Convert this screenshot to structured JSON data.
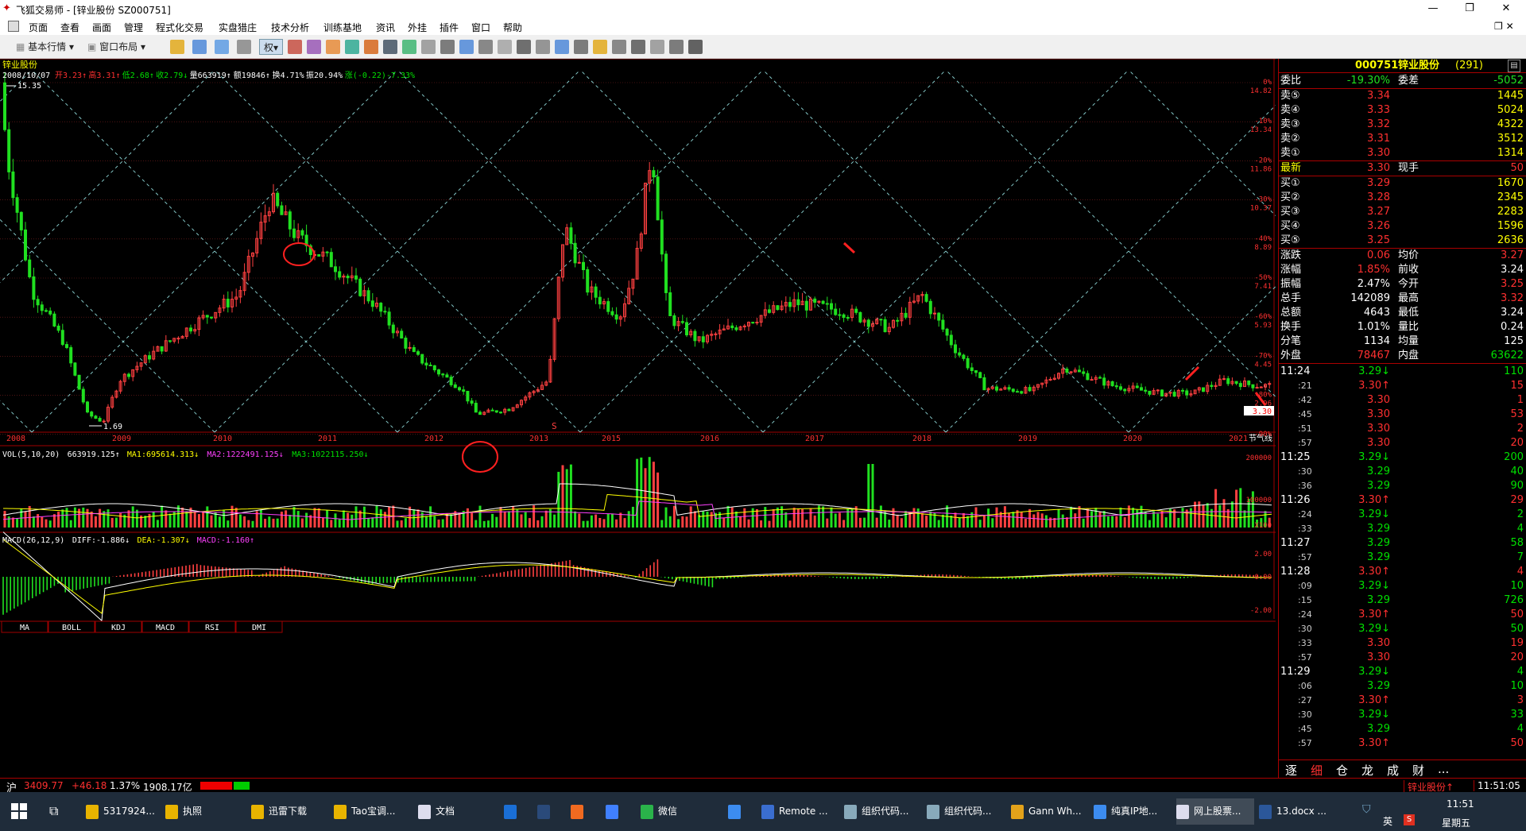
{
  "window": {
    "title": "飞狐交易师 - [锌业股份 SZ000751]"
  },
  "menu": [
    "页面",
    "查看",
    "画面",
    "管理",
    "程式化交易",
    "实盘猎庄",
    "技术分析",
    "训练基地",
    "资讯",
    "外挂",
    "插件",
    "窗口",
    "帮助"
  ],
  "toolbar": {
    "basic": "基本行情",
    "layout": "窗口布局",
    "quan": "权"
  },
  "chart": {
    "stock_name": "锌业股份",
    "info_date": "2008/10/07",
    "info_items": [
      {
        "t": "开3.23↑",
        "c": "#ff3030"
      },
      {
        "t": "高3.31↑",
        "c": "#ff3030"
      },
      {
        "t": "低2.68↑",
        "c": "#00e000"
      },
      {
        "t": "收2.79↓",
        "c": "#00e000"
      },
      {
        "t": "量663919↑",
        "c": "#ffffff"
      },
      {
        "t": "额19846↑",
        "c": "#ffffff"
      },
      {
        "t": "换4.71%",
        "c": "#ffffff"
      },
      {
        "t": "振20.94%",
        "c": "#ffffff"
      },
      {
        "t": "涨(-0.22)-7.33%",
        "c": "#00e000"
      }
    ],
    "high_label": "15.35",
    "low_label": "1.69",
    "s_mark": "S",
    "years": [
      "2008",
      "2009",
      "2010",
      "2011",
      "2012",
      "2013",
      "2015",
      "2016",
      "2017",
      "2018",
      "2019",
      "2020",
      "2021"
    ],
    "right_labels": [
      {
        "p": "0%",
        "v": "14.82"
      },
      {
        "p": "-10%",
        "v": "13.34"
      },
      {
        "p": "-20%",
        "v": "11.86"
      },
      {
        "p": "-30%",
        "v": "10.37"
      },
      {
        "p": "-40%",
        "v": "8.89"
      },
      {
        "p": "-50%",
        "v": "7.41"
      },
      {
        "p": "-60%",
        "v": "5.93"
      },
      {
        "p": "-70%",
        "v": "4.45"
      },
      {
        "p": "-80%",
        "v": "2.96"
      },
      {
        "p": "-90%",
        "v": ""
      }
    ],
    "current_price": "3.30",
    "solar_term": "节气线",
    "vol": {
      "title": "VOL(5,10,20)",
      "val": "663919.125↑",
      "ma1": "MA1:695614.313↓",
      "ma2": "MA2:1222491.125↓",
      "ma3": "MA3:1022115.250↓",
      "ticks": [
        "200000",
        "100000"
      ],
      "unit": "X100"
    },
    "macd": {
      "title": "MACD(26,12,9)",
      "diff": "DIFF:-1.886↓",
      "dea": "DEA:-1.307↓",
      "macd": "MACD:-1.160↑",
      "ticks": [
        "2.00",
        "0.00",
        "-2.00"
      ]
    },
    "tabs": [
      "MA",
      "BOLL",
      "KDJ",
      "MACD",
      "RSI",
      "DMI"
    ]
  },
  "quote": {
    "code": "000751",
    "name": "锌业股份",
    "num": "(291)",
    "weibi_l": "委比",
    "weibi_v": "-19.30%",
    "weicha_l": "委差",
    "weicha_v": "-5052",
    "sells": [
      {
        "l": "卖⑤",
        "p": "3.34",
        "v": "1445"
      },
      {
        "l": "卖④",
        "p": "3.33",
        "v": "5024"
      },
      {
        "l": "卖③",
        "p": "3.32",
        "v": "4322"
      },
      {
        "l": "卖②",
        "p": "3.31",
        "v": "3512"
      },
      {
        "l": "卖①",
        "p": "3.30",
        "v": "1314"
      }
    ],
    "latest_l": "最新",
    "latest_p": "3.30",
    "xianshou_l": "现手",
    "xianshou_v": "50",
    "buys": [
      {
        "l": "买①",
        "p": "3.29",
        "v": "1670"
      },
      {
        "l": "买②",
        "p": "3.28",
        "v": "2345"
      },
      {
        "l": "买③",
        "p": "3.27",
        "v": "2283"
      },
      {
        "l": "买④",
        "p": "3.26",
        "v": "1596"
      },
      {
        "l": "买⑤",
        "p": "3.25",
        "v": "2636"
      }
    ],
    "stats": [
      {
        "l1": "涨跌",
        "v1": "0.06",
        "c1": "#ff3030",
        "l2": "均价",
        "v2": "3.27",
        "c2": "#ff3030"
      },
      {
        "l1": "涨幅",
        "v1": "1.85%",
        "c1": "#ff3030",
        "l2": "前收",
        "v2": "3.24",
        "c2": "#ffffff"
      },
      {
        "l1": "振幅",
        "v1": "2.47%",
        "c1": "#ffffff",
        "l2": "今开",
        "v2": "3.25",
        "c2": "#ff3030"
      },
      {
        "l1": "总手",
        "v1": "142089",
        "c1": "#ffffff",
        "l2": "最高",
        "v2": "3.32",
        "c2": "#ff3030"
      },
      {
        "l1": "总额",
        "v1": "4643",
        "c1": "#ffffff",
        "l2": "最低",
        "v2": "3.24",
        "c2": "#ffffff"
      },
      {
        "l1": "换手",
        "v1": "1.01%",
        "c1": "#ffffff",
        "l2": "量比",
        "v2": "0.24",
        "c2": "#ffffff"
      },
      {
        "l1": "分笔",
        "v1": "1134",
        "c1": "#ffffff",
        "l2": "均量",
        "v2": "125",
        "c2": "#ffffff"
      },
      {
        "l1": "外盘",
        "v1": "78467",
        "c1": "#ff3030",
        "l2": "内盘",
        "v2": "63622",
        "c2": "#00e000"
      }
    ],
    "ticks": [
      {
        "t": "11:24",
        "p": "3.29↓",
        "v": "110",
        "c": "#00e000"
      },
      {
        "t": ":21",
        "p": "3.30↑",
        "v": "15",
        "c": "#ff3030"
      },
      {
        "t": ":42",
        "p": "3.30",
        "v": "1",
        "c": "#ff3030"
      },
      {
        "t": ":45",
        "p": "3.30",
        "v": "53",
        "c": "#ff3030"
      },
      {
        "t": ":51",
        "p": "3.30",
        "v": "2",
        "c": "#ff3030"
      },
      {
        "t": ":57",
        "p": "3.30",
        "v": "20",
        "c": "#ff3030"
      },
      {
        "t": "11:25",
        "p": "3.29↓",
        "v": "200",
        "c": "#00e000"
      },
      {
        "t": ":30",
        "p": "3.29",
        "v": "40",
        "c": "#00e000"
      },
      {
        "t": ":36",
        "p": "3.29",
        "v": "90",
        "c": "#00e000"
      },
      {
        "t": "11:26",
        "p": "3.30↑",
        "v": "29",
        "c": "#ff3030"
      },
      {
        "t": ":24",
        "p": "3.29↓",
        "v": "2",
        "c": "#00e000"
      },
      {
        "t": ":33",
        "p": "3.29",
        "v": "4",
        "c": "#00e000"
      },
      {
        "t": "11:27",
        "p": "3.29",
        "v": "58",
        "c": "#00e000"
      },
      {
        "t": ":57",
        "p": "3.29",
        "v": "7",
        "c": "#00e000"
      },
      {
        "t": "11:28",
        "p": "3.30↑",
        "v": "4",
        "c": "#ff3030"
      },
      {
        "t": ":09",
        "p": "3.29↓",
        "v": "10",
        "c": "#00e000"
      },
      {
        "t": ":15",
        "p": "3.29",
        "v": "726",
        "c": "#00e000"
      },
      {
        "t": ":24",
        "p": "3.30↑",
        "v": "50",
        "c": "#ff3030"
      },
      {
        "t": ":30",
        "p": "3.29↓",
        "v": "50",
        "c": "#00e000"
      },
      {
        "t": ":33",
        "p": "3.30",
        "v": "19",
        "c": "#ff3030"
      },
      {
        "t": ":57",
        "p": "3.30",
        "v": "20",
        "c": "#ff3030"
      },
      {
        "t": "11:29",
        "p": "3.29↓",
        "v": "4",
        "c": "#00e000"
      },
      {
        "t": ":06",
        "p": "3.29",
        "v": "10",
        "c": "#00e000"
      },
      {
        "t": ":27",
        "p": "3.30↑",
        "v": "3",
        "c": "#ff3030"
      },
      {
        "t": ":30",
        "p": "3.29↓",
        "v": "33",
        "c": "#00e000"
      },
      {
        "t": ":45",
        "p": "3.29",
        "v": "4",
        "c": "#00e000"
      },
      {
        "t": ":57",
        "p": "3.30↑",
        "v": "50",
        "c": "#ff3030"
      }
    ],
    "bottom_tabs": [
      "逐",
      "细",
      "仓",
      "龙",
      "成",
      "财",
      "..."
    ]
  },
  "status": {
    "index": "沪",
    "val": "3409.77",
    "chg": "+46.18",
    "pct": "1.37%",
    "amt": "1908.17亿",
    "stock": "锌业股份↑",
    "time": "11:51:05"
  },
  "taskbar": {
    "items": [
      {
        "l": "5317924...",
        "c": "#e8b400"
      },
      {
        "l": "执照",
        "c": "#e8b400"
      },
      {
        "l": "迅雷下载",
        "c": "#e8b400"
      },
      {
        "l": "Tao宝调...",
        "c": "#e8b400"
      },
      {
        "l": "文档",
        "c": "#dde"
      },
      {
        "l": "",
        "c": "#1a6fd6"
      },
      {
        "l": "",
        "c": "#2a4a7a"
      },
      {
        "l": "",
        "c": "#f06a20"
      },
      {
        "l": "",
        "c": "#4080ff"
      },
      {
        "l": "微信",
        "c": "#2ab34a"
      },
      {
        "l": "",
        "c": "#3c8cf0"
      },
      {
        "l": "Remote ...",
        "c": "#3a6ed0"
      },
      {
        "l": "组织代码...",
        "c": "#8ab"
      },
      {
        "l": "组织代码...",
        "c": "#8ab"
      },
      {
        "l": "Gann Wh...",
        "c": "#e3a21a"
      },
      {
        "l": "纯真IP地...",
        "c": "#3c8cf0"
      },
      {
        "l": "网上股票...",
        "c": "#dde"
      },
      {
        "l": "13.docx ...",
        "c": "#2b579a"
      }
    ],
    "clock": "11:51",
    "day": "星期五",
    "ime": "英"
  }
}
